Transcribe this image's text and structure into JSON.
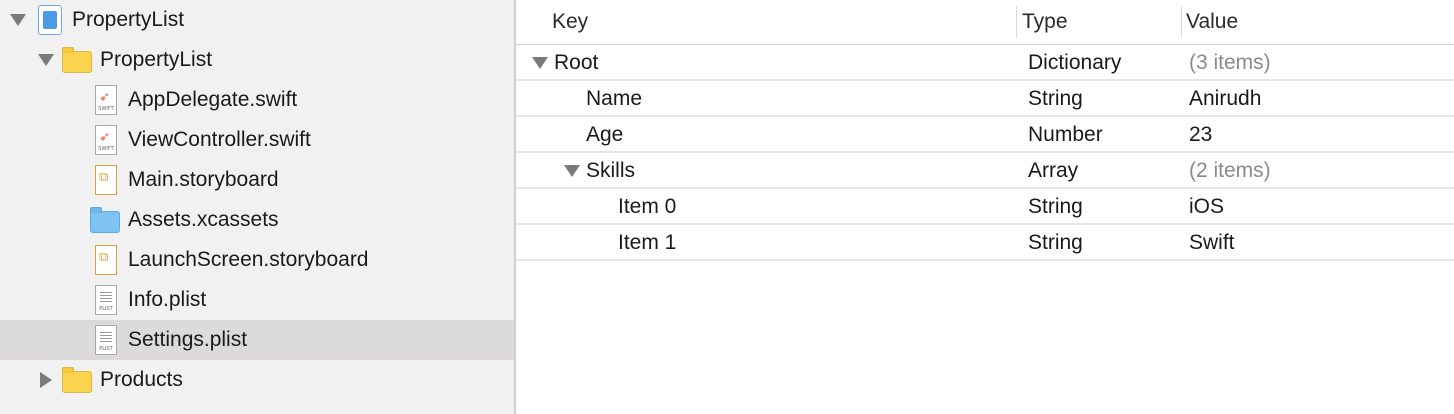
{
  "navigator": {
    "items": [
      {
        "label": "PropertyList",
        "icon": "xcode-project-icon",
        "indent": 0,
        "disclosure": "expanded"
      },
      {
        "label": "PropertyList",
        "icon": "folder-icon",
        "indent": 1,
        "disclosure": "expanded"
      },
      {
        "label": "AppDelegate.swift",
        "icon": "swift-file-icon",
        "indent": 2,
        "disclosure": "none"
      },
      {
        "label": "ViewController.swift",
        "icon": "swift-file-icon",
        "indent": 2,
        "disclosure": "none"
      },
      {
        "label": "Main.storyboard",
        "icon": "storyboard-file-icon",
        "indent": 2,
        "disclosure": "none"
      },
      {
        "label": "Assets.xcassets",
        "icon": "asset-catalog-icon",
        "indent": 2,
        "disclosure": "none"
      },
      {
        "label": "LaunchScreen.storyboard",
        "icon": "storyboard-file-icon",
        "indent": 2,
        "disclosure": "none"
      },
      {
        "label": "Info.plist",
        "icon": "plist-file-icon",
        "indent": 2,
        "disclosure": "none"
      },
      {
        "label": "Settings.plist",
        "icon": "plist-file-icon",
        "indent": 2,
        "disclosure": "none",
        "selected": true
      },
      {
        "label": "Products",
        "icon": "folder-icon",
        "indent": 1,
        "disclosure": "collapsed"
      }
    ],
    "file_tags": {
      "swift": "SWIFT",
      "plist": "PLIST"
    }
  },
  "editor": {
    "columns": {
      "key": "Key",
      "type": "Type",
      "value": "Value"
    },
    "rows": [
      {
        "key": "Root",
        "type": "Dictionary",
        "value": "(3 items)",
        "level": 0,
        "disclosure": "expanded",
        "value_muted": true
      },
      {
        "key": "Name",
        "type": "String",
        "value": "Anirudh",
        "level": 1,
        "disclosure": "none",
        "value_muted": false
      },
      {
        "key": "Age",
        "type": "Number",
        "value": "23",
        "level": 1,
        "disclosure": "none",
        "value_muted": false
      },
      {
        "key": "Skills",
        "type": "Array",
        "value": "(2 items)",
        "level": 1,
        "disclosure": "expanded",
        "value_muted": true
      },
      {
        "key": "Item 0",
        "type": "String",
        "value": "iOS",
        "level": 2,
        "disclosure": "none",
        "value_muted": false
      },
      {
        "key": "Item 1",
        "type": "String",
        "value": "Swift",
        "level": 2,
        "disclosure": "none",
        "value_muted": false
      }
    ]
  },
  "colors": {
    "navigator_bg": "#f2f1f1",
    "selected_row": "#dcdadb",
    "muted_text": "#8a8a8a",
    "swift_orange": "#f05138",
    "folder_yellow": "#fbd44f"
  }
}
